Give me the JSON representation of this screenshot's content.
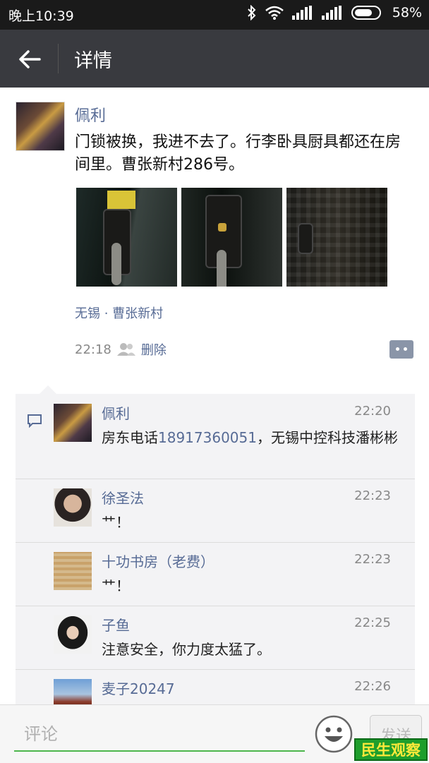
{
  "status_bar": {
    "time": "晚上10:39",
    "battery": "58%"
  },
  "header": {
    "title": "详情"
  },
  "post": {
    "author": "佩利",
    "text": "门锁被换，我进不去了。行李卧具厨具都还在房间里。曹张新村286号。",
    "location": "无锡 · 曹张新村",
    "time": "22:18",
    "delete_label": "删除"
  },
  "comments": [
    {
      "name": "佩利",
      "time": "22:20",
      "text_before": "房东电话",
      "phone": "18917360051",
      "text_after": "，无锡中控科技潘彬彬"
    },
    {
      "name": "徐圣法",
      "time": "22:23",
      "text": "艹！"
    },
    {
      "name": "十功书房（老费）",
      "time": "22:23",
      "text": "艹！"
    },
    {
      "name": "子鱼",
      "time": "22:25",
      "text": "注意安全，你力度太猛了。"
    },
    {
      "name": "麦子20247",
      "time": "22:26",
      "text": ""
    }
  ],
  "input_bar": {
    "placeholder": "评论",
    "send_label": "发送"
  },
  "watermark": "民生观察",
  "colors": {
    "link": "#576b95",
    "appbar": "#393a3f",
    "accent_green": "#4cb64c"
  }
}
